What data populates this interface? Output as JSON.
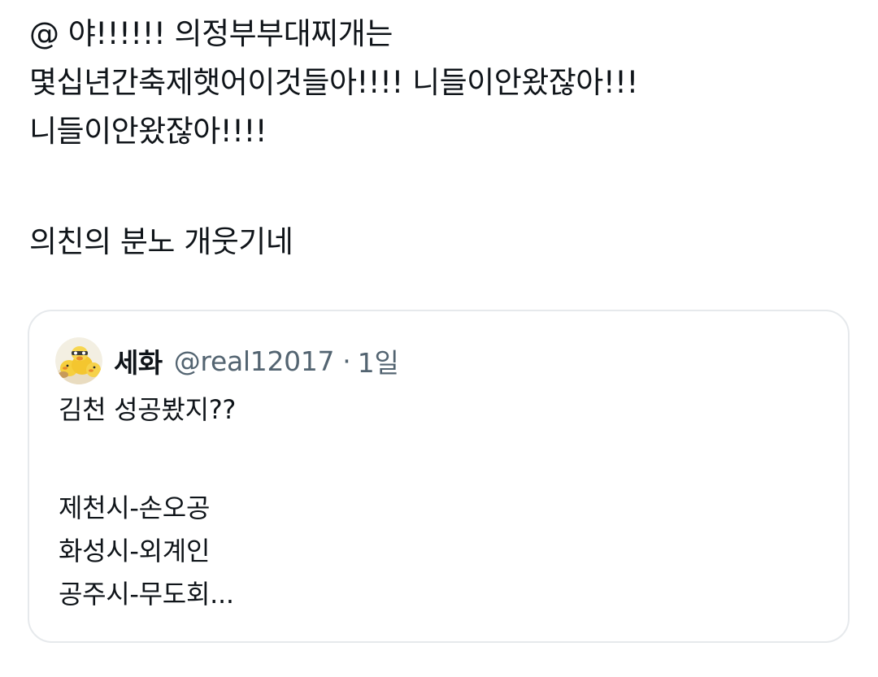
{
  "tweet": {
    "lines": [
      "@ 야!!!!!! 의정부부대찌개는",
      "몇십년간축제햇어이것들아!!!! 니들이안왔잖아!!!",
      "니들이안왔잖아!!!!",
      "의친의 분노 개웃기네"
    ]
  },
  "quote": {
    "author_name": "세화",
    "author_handle": "@real12017",
    "separator": "·",
    "time": "1일",
    "avatar_icon": "duck-avatar-icon",
    "lines": [
      "김천 성공봤지??",
      "제천시-손오공",
      "화성시-외계인",
      "공주시-무도회..."
    ]
  },
  "colors": {
    "text": "#0f1419",
    "secondary": "#536471",
    "border": "#e6e9ec",
    "background": "#ffffff"
  }
}
